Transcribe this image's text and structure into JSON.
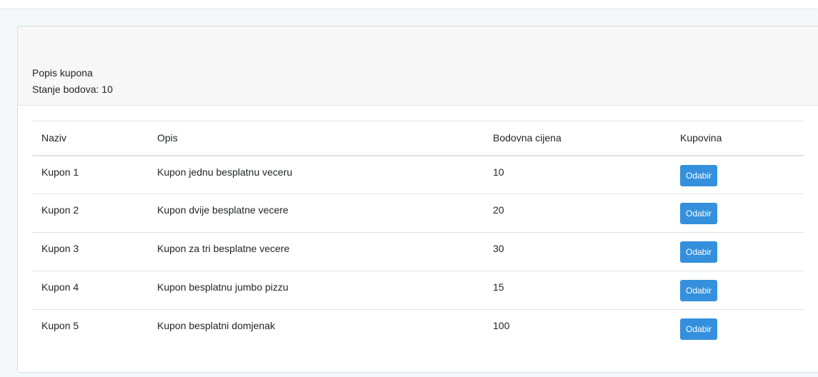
{
  "header": {
    "title": "Popis kupona",
    "balance": "Stanje bodova: 10"
  },
  "table": {
    "columns": [
      "Naziv",
      "Opis",
      "Bodovna cijena",
      "Kupovina"
    ],
    "rows": [
      {
        "name": "Kupon 1",
        "description": "Kupon jednu besplatnu veceru",
        "price": "10",
        "action": "Odabir"
      },
      {
        "name": "Kupon 2",
        "description": "Kupon dvije besplatne vecere",
        "price": "20",
        "action": "Odabir"
      },
      {
        "name": "Kupon 3",
        "description": "Kupon za tri besplatne vecere",
        "price": "30",
        "action": "Odabir"
      },
      {
        "name": "Kupon 4",
        "description": "Kupon besplatnu jumbo pizzu",
        "price": "15",
        "action": "Odabir"
      },
      {
        "name": "Kupon 5",
        "description": "Kupon besplatni domjenak",
        "price": "100",
        "action": "Odabir"
      }
    ]
  },
  "colors": {
    "button": "#3490dc",
    "page_background": "#f5f8fa",
    "card_header": "#f7f7f7"
  }
}
